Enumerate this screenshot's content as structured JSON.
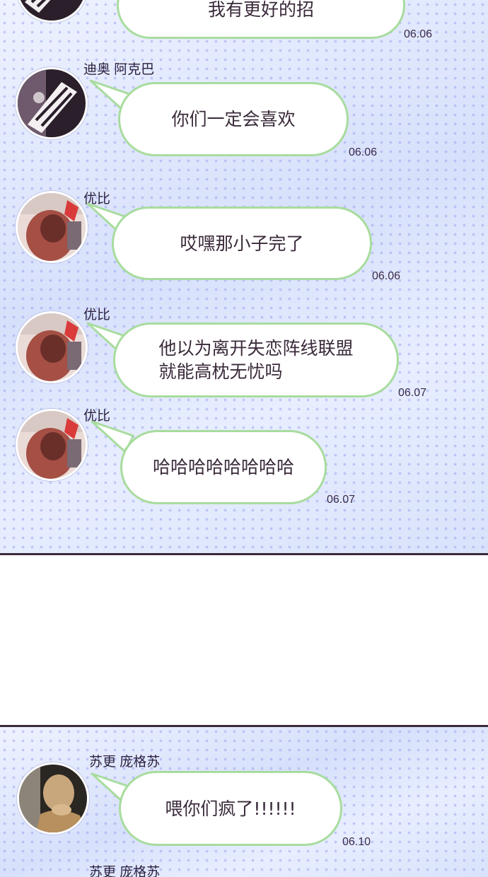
{
  "messages": [
    {
      "sender": "",
      "text": "我有更好的招",
      "time": "06.06",
      "avatar": "sneaker-avatar"
    },
    {
      "sender": "迪奥 阿克巴",
      "text": "你们一定会喜欢",
      "time": "06.06",
      "avatar": "sneaker-avatar"
    },
    {
      "sender": "优比",
      "text": "哎嘿那小子完了",
      "time": "06.06",
      "avatar": "photo-avatar-red"
    },
    {
      "sender": "优比",
      "text": "他以为离开失恋阵线联盟\n就能高枕无忧吗",
      "time": "06.07",
      "avatar": "photo-avatar-red"
    },
    {
      "sender": "优比",
      "text": "哈哈哈哈哈哈哈哈",
      "time": "06.07",
      "avatar": "photo-avatar-red"
    },
    {
      "sender": "苏更 庞格苏",
      "text": "喂你们疯了!!!!!!",
      "time": "06.10",
      "avatar": "photo-avatar-dark"
    },
    {
      "sender": "苏更 庞格苏",
      "text": "",
      "time": "",
      "avatar": ""
    }
  ],
  "colors": {
    "bubble_border": "#a8dc9e",
    "text": "#3a2a3a",
    "panel_background": "#dfe6fb",
    "divider": "#3a2a3a"
  }
}
